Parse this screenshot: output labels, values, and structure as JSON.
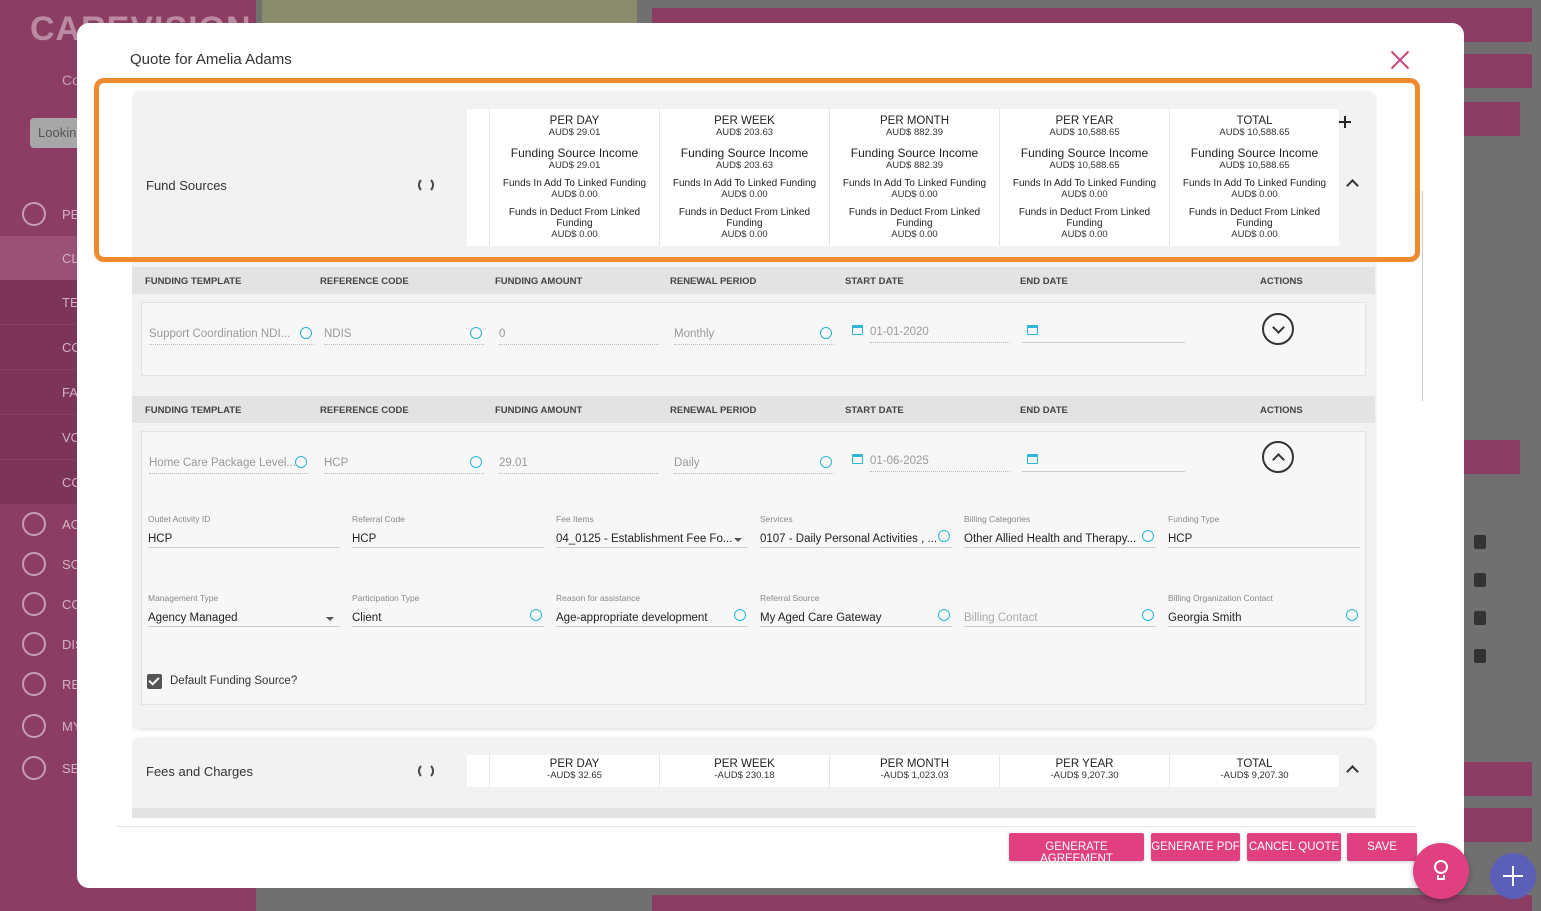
{
  "background": {
    "logo": "CAREVISION",
    "company_abbrev": "Co",
    "search_placeholder": "Lookin",
    "nav": [
      "PE",
      "CL",
      "TE",
      "CO",
      "FA",
      "VO",
      "CO",
      "AC",
      "SC",
      "CO",
      "DIS",
      "RE",
      "MY",
      "SE"
    ]
  },
  "modal": {
    "title": "Quote for Amelia Adams"
  },
  "fund_sources": {
    "title": "Fund Sources",
    "columns": [
      {
        "header": "PER DAY",
        "total": "AUD$ 29.01",
        "income_label": "Funding Source Income",
        "income": "AUD$ 29.01",
        "add_label": "Funds In Add To Linked Funding",
        "add": "AUD$ 0.00",
        "deduct_label": "Funds in Deduct From Linked Funding",
        "deduct": "AUD$ 0.00"
      },
      {
        "header": "PER WEEK",
        "total": "AUD$ 203.63",
        "income_label": "Funding Source Income",
        "income": "AUD$ 203.63",
        "add_label": "Funds In Add To Linked Funding",
        "add": "AUD$ 0.00",
        "deduct_label": "Funds in Deduct From Linked Funding",
        "deduct": "AUD$ 0.00"
      },
      {
        "header": "PER MONTH",
        "total": "AUD$ 882.39",
        "income_label": "Funding Source Income",
        "income": "AUD$ 882.39",
        "add_label": "Funds In Add To Linked Funding",
        "add": "AUD$ 0.00",
        "deduct_label": "Funds in Deduct From Linked Funding",
        "deduct": "AUD$ 0.00"
      },
      {
        "header": "PER YEAR",
        "total": "AUD$ 10,588.65",
        "income_label": "Funding Source Income",
        "income": "AUD$ 10,588.65",
        "add_label": "Funds In Add To Linked Funding",
        "add": "AUD$ 0.00",
        "deduct_label": "Funds in Deduct From Linked Funding",
        "deduct": "AUD$ 0.00"
      },
      {
        "header": "TOTAL",
        "total": "AUD$ 10,588.65",
        "income_label": "Funding Source Income",
        "income": "AUD$ 10,588.65",
        "add_label": "Funds In Add To Linked Funding",
        "add": "AUD$ 0.00",
        "deduct_label": "Funds in Deduct From Linked Funding",
        "deduct": "AUD$ 0.00"
      }
    ],
    "table_headers": [
      "FUNDING TEMPLATE",
      "REFERENCE CODE",
      "FUNDING AMOUNT",
      "RENEWAL PERIOD",
      "START DATE",
      "END DATE",
      "ACTIONS"
    ],
    "rows": [
      {
        "template": "Support Coordination NDI...",
        "reference": "NDIS",
        "amount": "0",
        "renewal": "Monthly",
        "start": "01-01-2020",
        "end": ""
      },
      {
        "template": "Home Care Package Level...",
        "reference": "HCP",
        "amount": "29.01",
        "renewal": "Daily",
        "start": "01-06-2025",
        "end": ""
      }
    ],
    "details": {
      "outlet_activity_id": {
        "label": "Outlet Activity ID",
        "value": "HCP"
      },
      "referral_code": {
        "label": "Referral Code",
        "value": "HCP"
      },
      "fee_items": {
        "label": "Fee Items",
        "value": "04_0125 - Establishment Fee Fo..."
      },
      "services": {
        "label": "Services",
        "value": "0107 - Daily Personal Activities , ..."
      },
      "billing_categories": {
        "label": "Billing Categories",
        "value": "Other Allied Health and Therapy..."
      },
      "funding_type": {
        "label": "Funding Type",
        "value": "HCP"
      },
      "management_type": {
        "label": "Management Type",
        "value": "Agency Managed"
      },
      "participation_type": {
        "label": "Participation Type",
        "value": "Client"
      },
      "reason": {
        "label": "Reason for assistance",
        "value": "Age-appropriate development"
      },
      "referral_source": {
        "label": "Referral Source",
        "value": "My Aged Care Gateway"
      },
      "billing_contact": {
        "label": "",
        "placeholder": "Billing Contact"
      },
      "billing_org_contact": {
        "label": "Billing Organization Contact",
        "value": "Georgia Smith"
      },
      "default_label": "Default Funding Source?"
    }
  },
  "fees": {
    "title": "Fees and Charges",
    "columns": [
      {
        "header": "PER DAY",
        "total": "-AUD$ 32.65"
      },
      {
        "header": "PER WEEK",
        "total": "-AUD$ 230.18"
      },
      {
        "header": "PER MONTH",
        "total": "-AUD$ 1,023.03"
      },
      {
        "header": "PER YEAR",
        "total": "-AUD$ 9,207.30"
      },
      {
        "header": "TOTAL",
        "total": "-AUD$ 9,207.30"
      }
    ]
  },
  "buttons": {
    "generate_agreement": "GENERATE AGREEMENT",
    "generate_pdf": "GENERATE PDF",
    "cancel_quote": "CANCEL QUOTE",
    "save": "SAVE"
  },
  "colors": {
    "accent": "#e0407f",
    "highlight": "#ef8b2f",
    "info": "#2bb5d8"
  }
}
